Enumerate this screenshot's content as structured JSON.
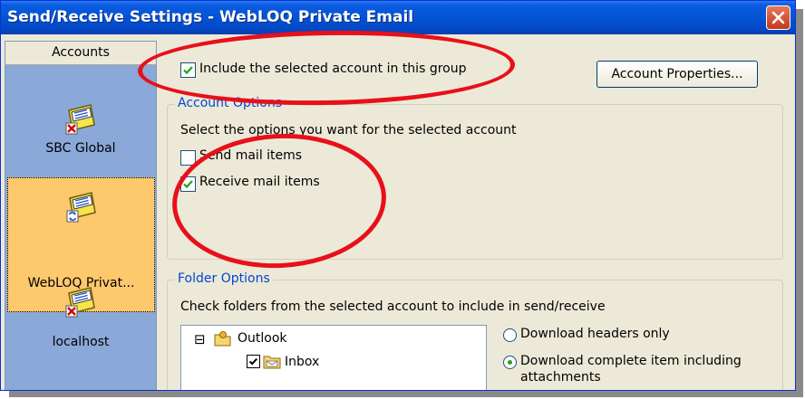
{
  "window": {
    "title": "Send/Receive Settings - WebLOQ Private Email"
  },
  "accounts_panel": {
    "header": "Accounts",
    "items": [
      {
        "label": "SBC Global",
        "icon": "mail-account-error-icon"
      },
      {
        "label": "WebLOQ Privat...",
        "icon": "mail-account-sync-icon",
        "selected": true
      },
      {
        "label": "localhost",
        "icon": "mail-account-error-icon"
      }
    ]
  },
  "include_checkbox": {
    "label": "Include the selected account in this group",
    "checked": true
  },
  "account_properties_button": "Account Properties...",
  "account_options": {
    "title": "Account Options",
    "description": "Select the options you want for the selected account",
    "send": {
      "label": "Send mail items",
      "checked": false
    },
    "receive": {
      "label": "Receive mail items",
      "checked": true
    }
  },
  "folder_options": {
    "title": "Folder Options",
    "description": "Check folders from the selected account to include in send/receive",
    "tree": {
      "expander": "⊟",
      "root_label": "Outlook",
      "child_label": "Inbox",
      "child_checked": true
    },
    "radio_headers": {
      "label": "Download headers only",
      "selected": false
    },
    "radio_complete": {
      "label_line1": "Download complete item including",
      "label_line2": "attachments",
      "selected": true
    }
  },
  "colors": {
    "title_bar": "#0453d6",
    "accent_text": "#0046d5",
    "selected_account_bg": "#fec86d",
    "annotation_red": "#e8101a"
  }
}
